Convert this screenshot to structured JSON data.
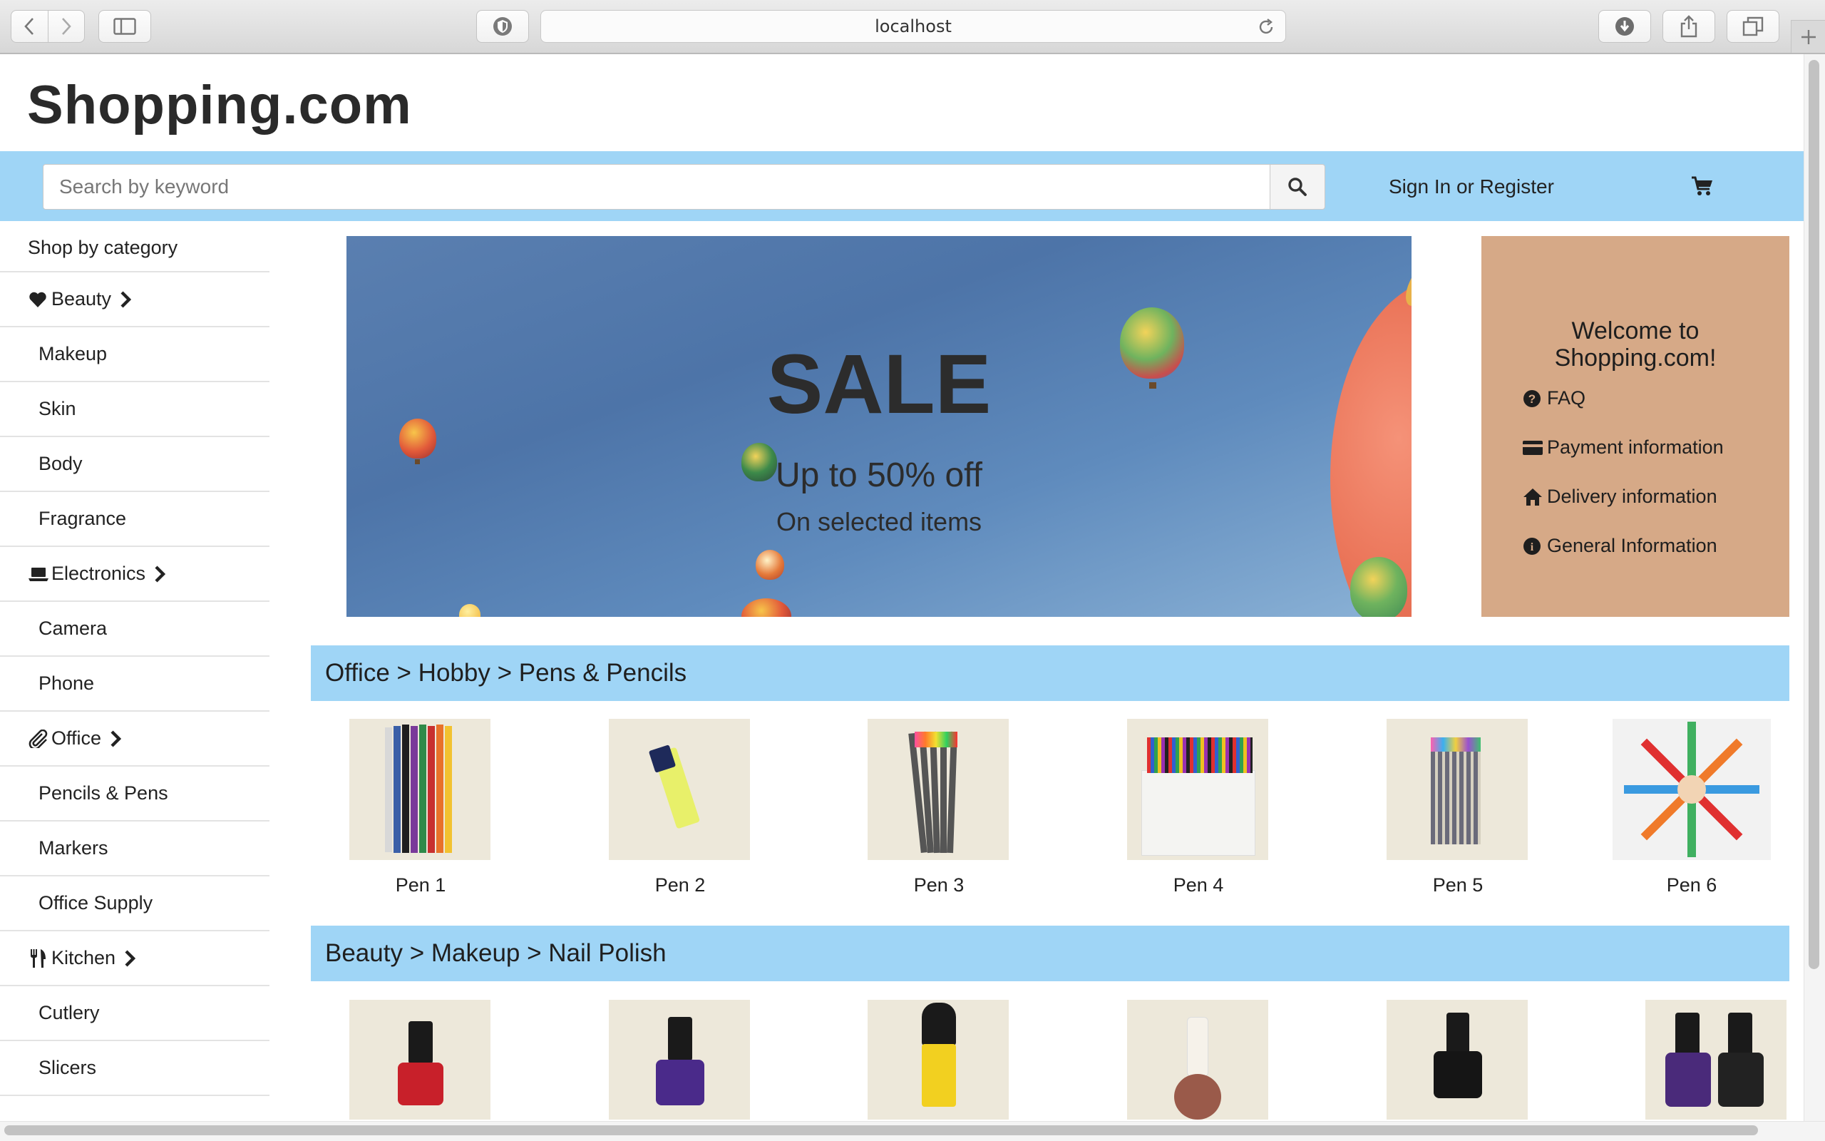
{
  "browser": {
    "url": "localhost",
    "icons": [
      "chevron-left-icon",
      "chevron-right-icon",
      "sidebar-icon",
      "privacy-shield-icon",
      "reload-icon",
      "download-icon",
      "share-icon",
      "tabs-icon",
      "plus-icon"
    ]
  },
  "header": {
    "brand": "Shopping.com",
    "search_placeholder": "Search by keyword",
    "signin_label": "Sign In or Register"
  },
  "sidebar": {
    "heading": "Shop by category",
    "categories": [
      {
        "label": "Beauty",
        "icon": "heart-icon",
        "items": [
          "Makeup",
          "Skin",
          "Body",
          "Fragrance"
        ]
      },
      {
        "label": "Electronics",
        "icon": "laptop-icon",
        "items": [
          "Camera",
          "Phone"
        ]
      },
      {
        "label": "Office",
        "icon": "paperclip-icon",
        "items": [
          "Pencils & Pens",
          "Markers",
          "Office Supply"
        ]
      },
      {
        "label": "Kitchen",
        "icon": "cutlery-icon",
        "items": [
          "Cutlery",
          "Slicers"
        ]
      }
    ]
  },
  "banner": {
    "title": "SALE",
    "subtitle": "Up to 50% off",
    "note": "On selected items"
  },
  "welcome": {
    "title_line1": "Welcome to",
    "title_line2": "Shopping.com!",
    "links": [
      {
        "label": "FAQ",
        "icon": "question-circle-icon"
      },
      {
        "label": "Payment information",
        "icon": "credit-card-icon"
      },
      {
        "label": "Delivery information",
        "icon": "home-icon"
      },
      {
        "label": "General Information",
        "icon": "info-circle-icon"
      }
    ]
  },
  "sections": [
    {
      "breadcrumb": "Office > Hobby > Pens & Pencils",
      "products": [
        "Pen 1",
        "Pen 2",
        "Pen 3",
        "Pen 4",
        "Pen 5",
        "Pen 6"
      ]
    },
    {
      "breadcrumb": "Beauty > Makeup > Nail Polish",
      "products": []
    }
  ],
  "colors": {
    "accent_blue": "#9fd5f6",
    "welcome_tan": "#d6a987",
    "banner_sky": "#5a7fb0"
  }
}
